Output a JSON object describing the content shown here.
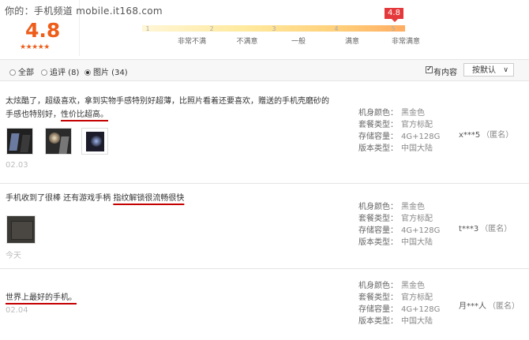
{
  "watermark": "你的：手机频道 mobile.it168.com",
  "rating": {
    "score": "4.8",
    "stars": "★★★★★"
  },
  "scale": {
    "current_value": "4.8",
    "ticks": [
      {
        "number": "1",
        "label": "非常不满"
      },
      {
        "number": "2",
        "label": "不满意"
      },
      {
        "number": "3",
        "label": "一般"
      },
      {
        "number": "4",
        "label": "满意"
      },
      {
        "number": "5",
        "label": "非常满意"
      }
    ]
  },
  "filters": {
    "all": "全部",
    "followup": "追评 (8)",
    "pictures": "图片 (34)",
    "has_content": "有内容",
    "sort": "按默认"
  },
  "spec_labels": {
    "color": "机身颜色：",
    "package": "套餐类型：",
    "storage": "存储容量：",
    "version": "版本类型："
  },
  "reviews": [
    {
      "text_line1": "太炫酷了，超级喜欢，拿到实物手感特别好超薄，比照片看着还要喜欢，赠送的手机壳磨砂的",
      "text_line2_pre": "手感也特别好，",
      "text_line2_hl": "性价比超高。",
      "date": "02.03",
      "color": "黑金色",
      "package": "官方标配",
      "storage": "4G+128G",
      "version": "中国大陆",
      "user": "x***5",
      "anon": "（匿名）"
    },
    {
      "text_pre": "手机收到了很棒 还有游戏手柄 ",
      "text_hl": "指纹解锁很流畅很快",
      "date": "今天",
      "color": "黑金色",
      "package": "官方标配",
      "storage": "4G+128G",
      "version": "中国大陆",
      "user": "t***3",
      "anon": "（匿名）"
    },
    {
      "text_hl": "世界上最好的手机。",
      "date": "02.04",
      "color": "黑金色",
      "package": "官方标配",
      "storage": "4G+128G",
      "version": "中国大陆",
      "user": "月***人",
      "anon": "（匿名）"
    }
  ]
}
